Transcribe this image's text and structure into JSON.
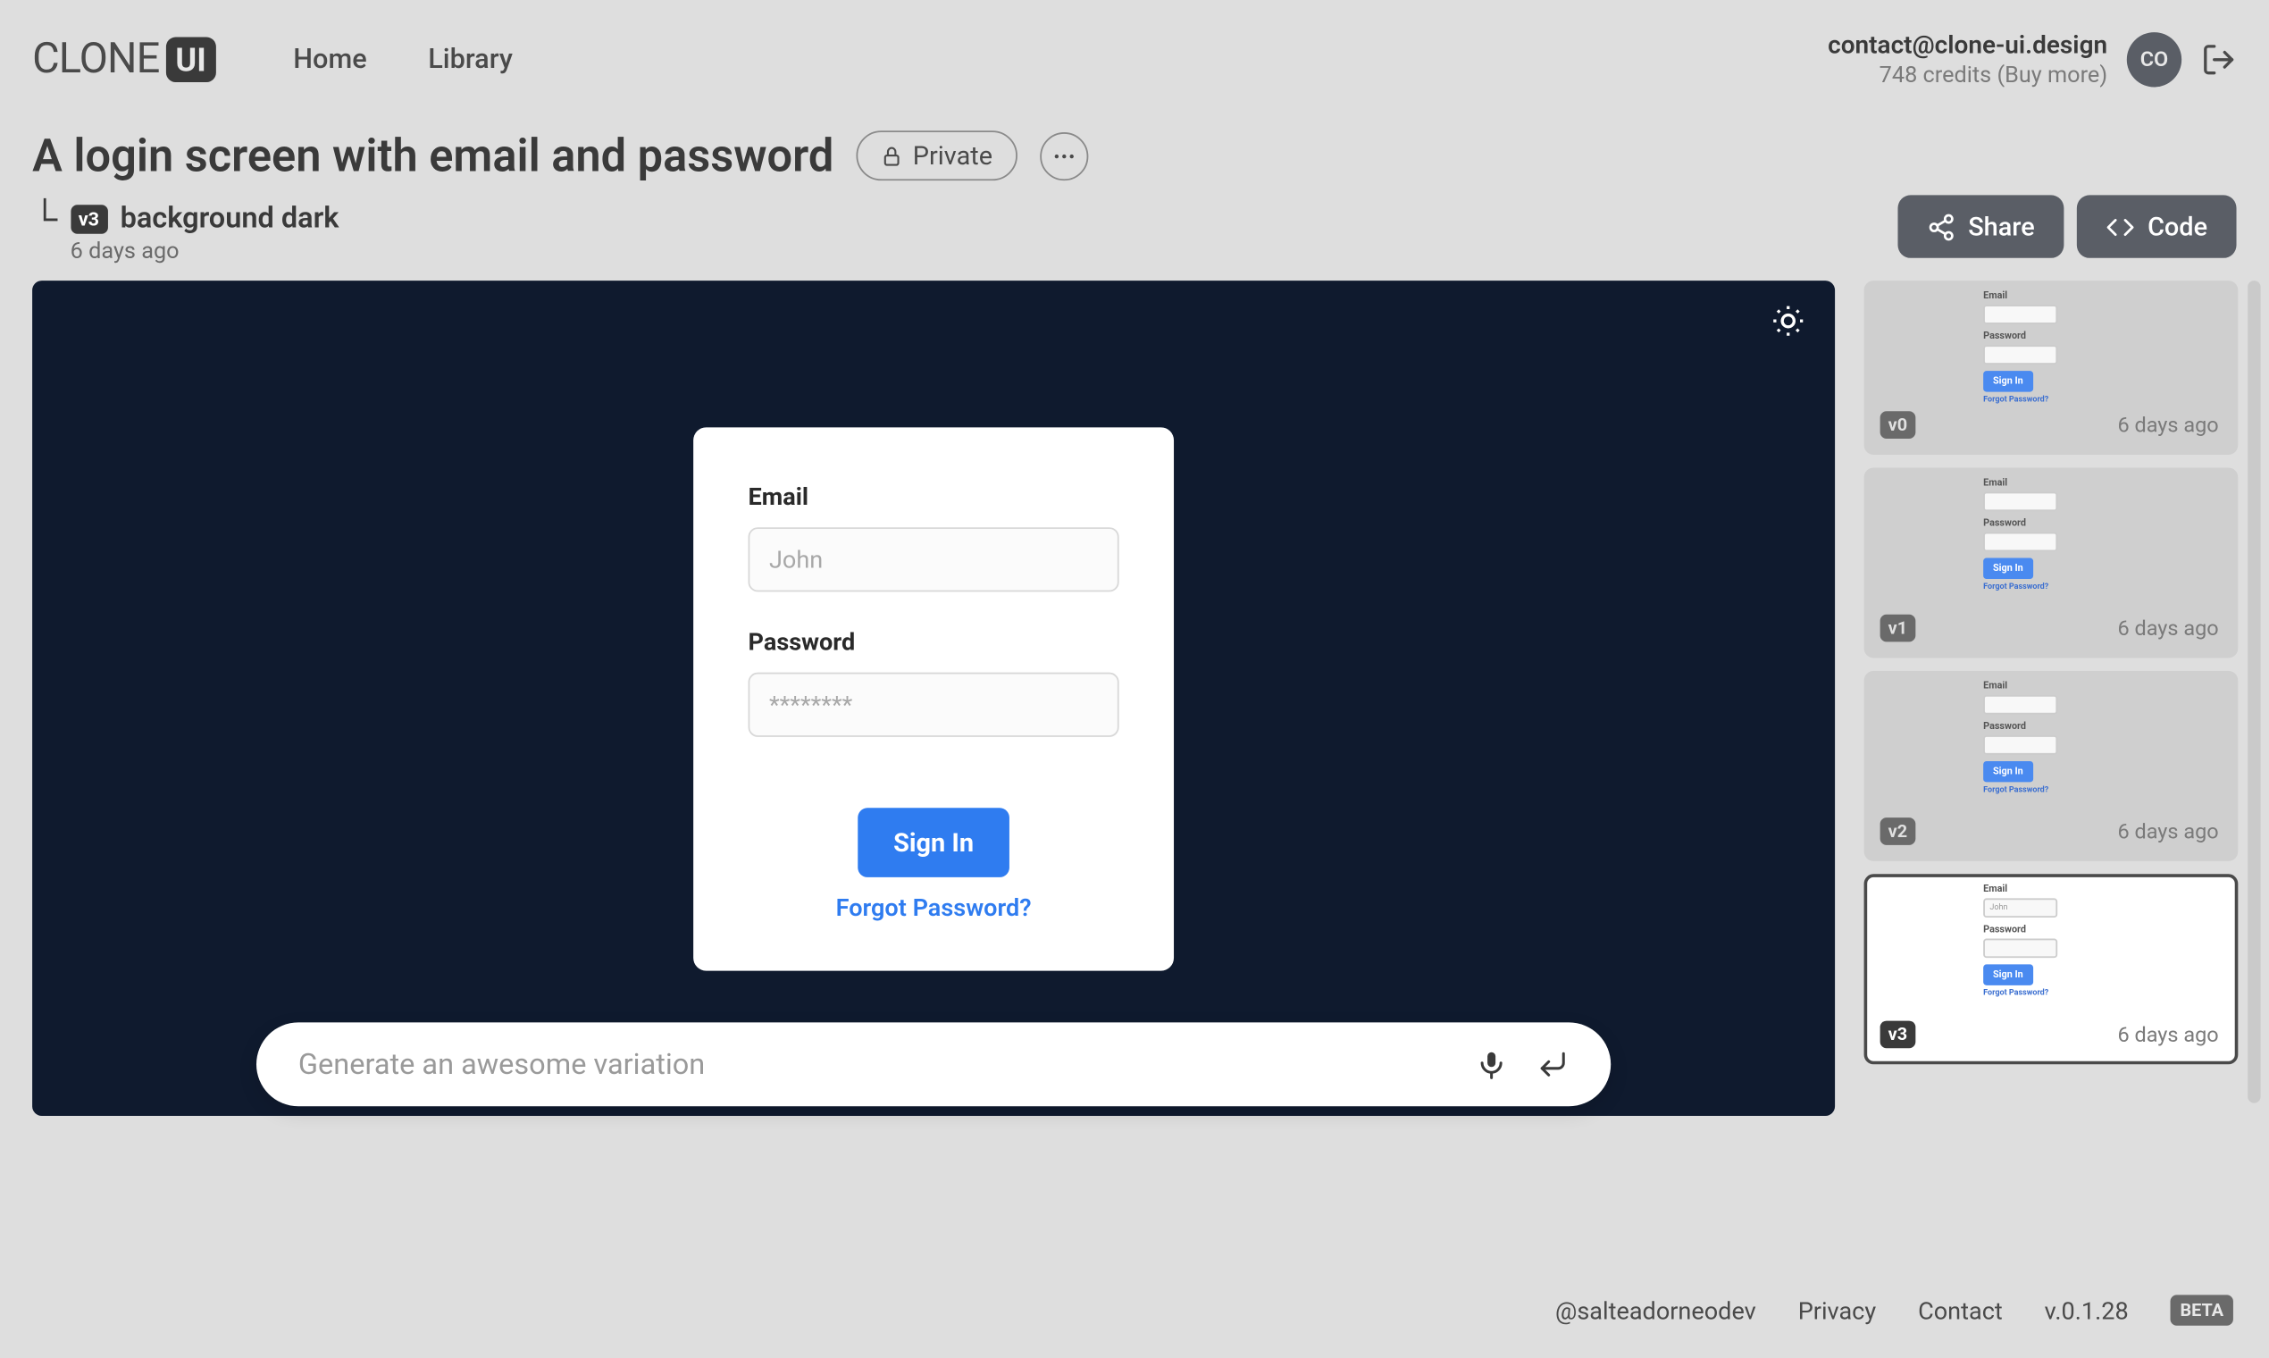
{
  "header": {
    "logo_text": "CLONE",
    "logo_badge": "UI",
    "nav": {
      "home": "Home",
      "library": "Library"
    },
    "user_email": "contact@clone-ui.design",
    "credits_text": "748 credits (Buy more)",
    "avatar_initials": "CO"
  },
  "project": {
    "title": "A login screen with email and password",
    "privacy": "Private"
  },
  "version": {
    "badge": "v3",
    "name": "background dark",
    "date": "6 days ago"
  },
  "actions": {
    "share": "Share",
    "code": "Code"
  },
  "login_card": {
    "email_label": "Email",
    "email_placeholder": "John",
    "password_label": "Password",
    "password_placeholder": "********",
    "signin": "Sign In",
    "forgot": "Forgot Password?"
  },
  "prompt": {
    "placeholder": "Generate an awesome variation"
  },
  "versions_list": [
    {
      "badge": "v0",
      "date": "6 days ago"
    },
    {
      "badge": "v1",
      "date": "6 days ago"
    },
    {
      "badge": "v2",
      "date": "6 days ago"
    },
    {
      "badge": "v3",
      "date": "6 days ago"
    }
  ],
  "footer": {
    "author": "@salteadorneodev",
    "privacy": "Privacy",
    "contact": "Contact",
    "version": "v.0.1.28",
    "badge": "BETA"
  }
}
